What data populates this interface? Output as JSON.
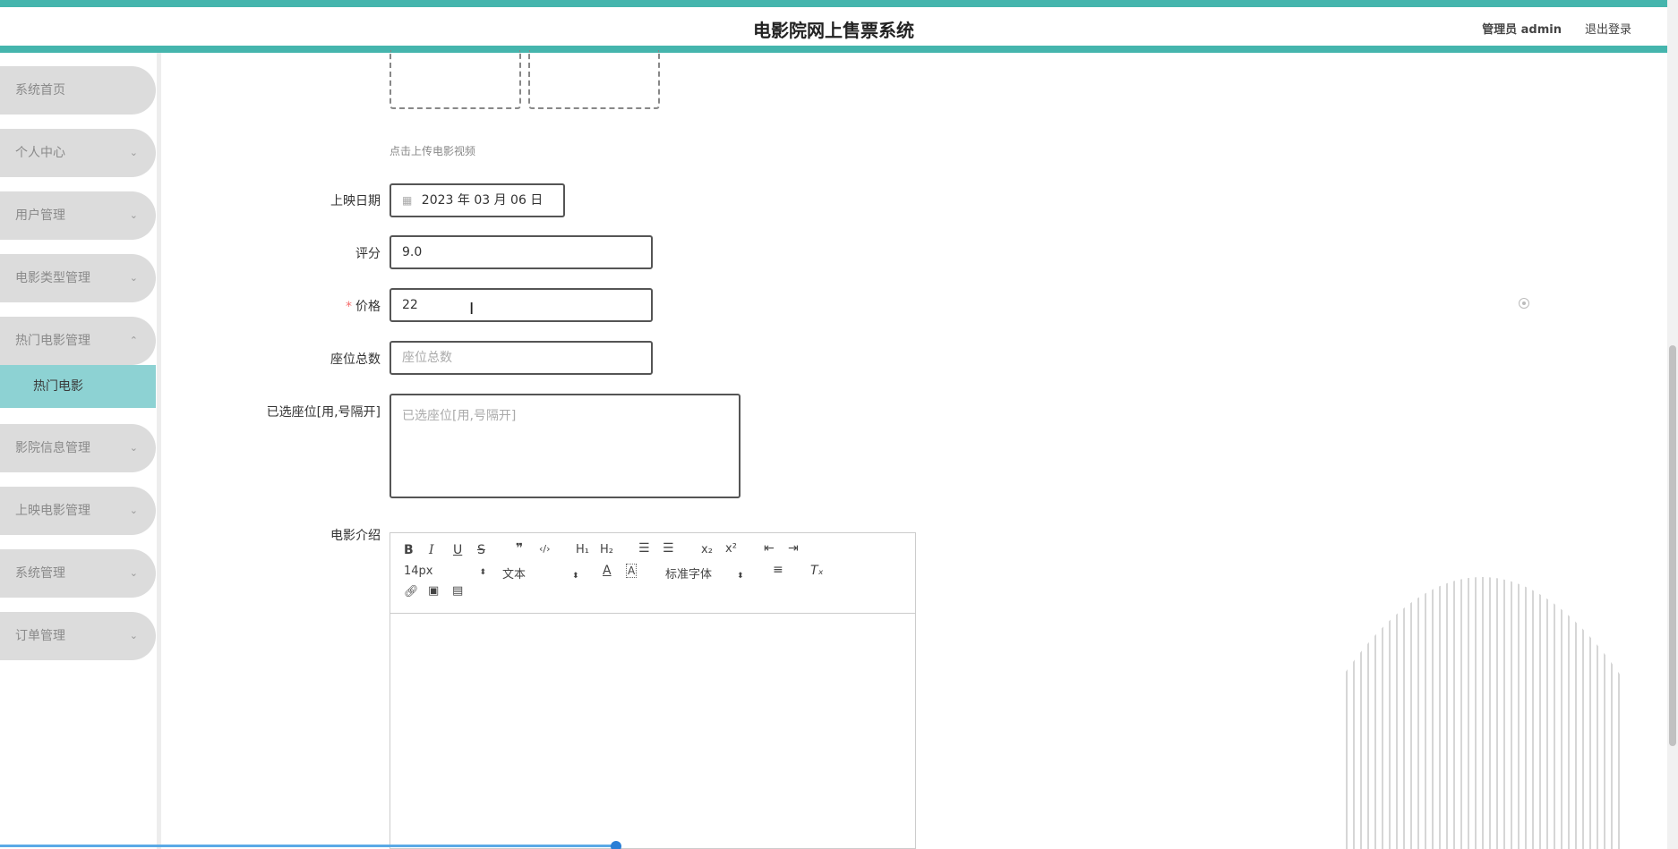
{
  "header": {
    "title": "电影院网上售票系统",
    "user": "管理员 admin",
    "logout": "退出登录"
  },
  "sidebar": {
    "items": [
      {
        "label": "系统首页",
        "expandable": false
      },
      {
        "label": "个人中心",
        "expandable": true
      },
      {
        "label": "用户管理",
        "expandable": true
      },
      {
        "label": "电影类型管理",
        "expandable": true
      },
      {
        "label": "热门电影管理",
        "expandable": true,
        "expanded": true
      },
      {
        "label": "影院信息管理",
        "expandable": true
      },
      {
        "label": "上映电影管理",
        "expandable": true
      },
      {
        "label": "系统管理",
        "expandable": true
      },
      {
        "label": "订单管理",
        "expandable": true
      }
    ],
    "active_sub": "热门电影"
  },
  "form": {
    "upload_hint": "点击上传电影视频",
    "release_date": {
      "label": "上映日期",
      "value": "2023 年 03 月 06 日"
    },
    "rating": {
      "label": "评分",
      "value": "9.0"
    },
    "price": {
      "label": "价格",
      "required_mark": "*",
      "value": "22"
    },
    "total_seats": {
      "label": "座位总数",
      "placeholder": "座位总数"
    },
    "selected_seats": {
      "label": "已选座位[用,号隔开]",
      "placeholder": "已选座位[用,号隔开]"
    },
    "intro": {
      "label": "电影介绍"
    }
  },
  "editor": {
    "font_size": "14px",
    "heading": "文本",
    "font_family": "标准字体"
  },
  "colors": {
    "accent": "#45b5ad",
    "submenu_active": "#8dd2d3",
    "menu_bg": "#dcdcdc"
  }
}
